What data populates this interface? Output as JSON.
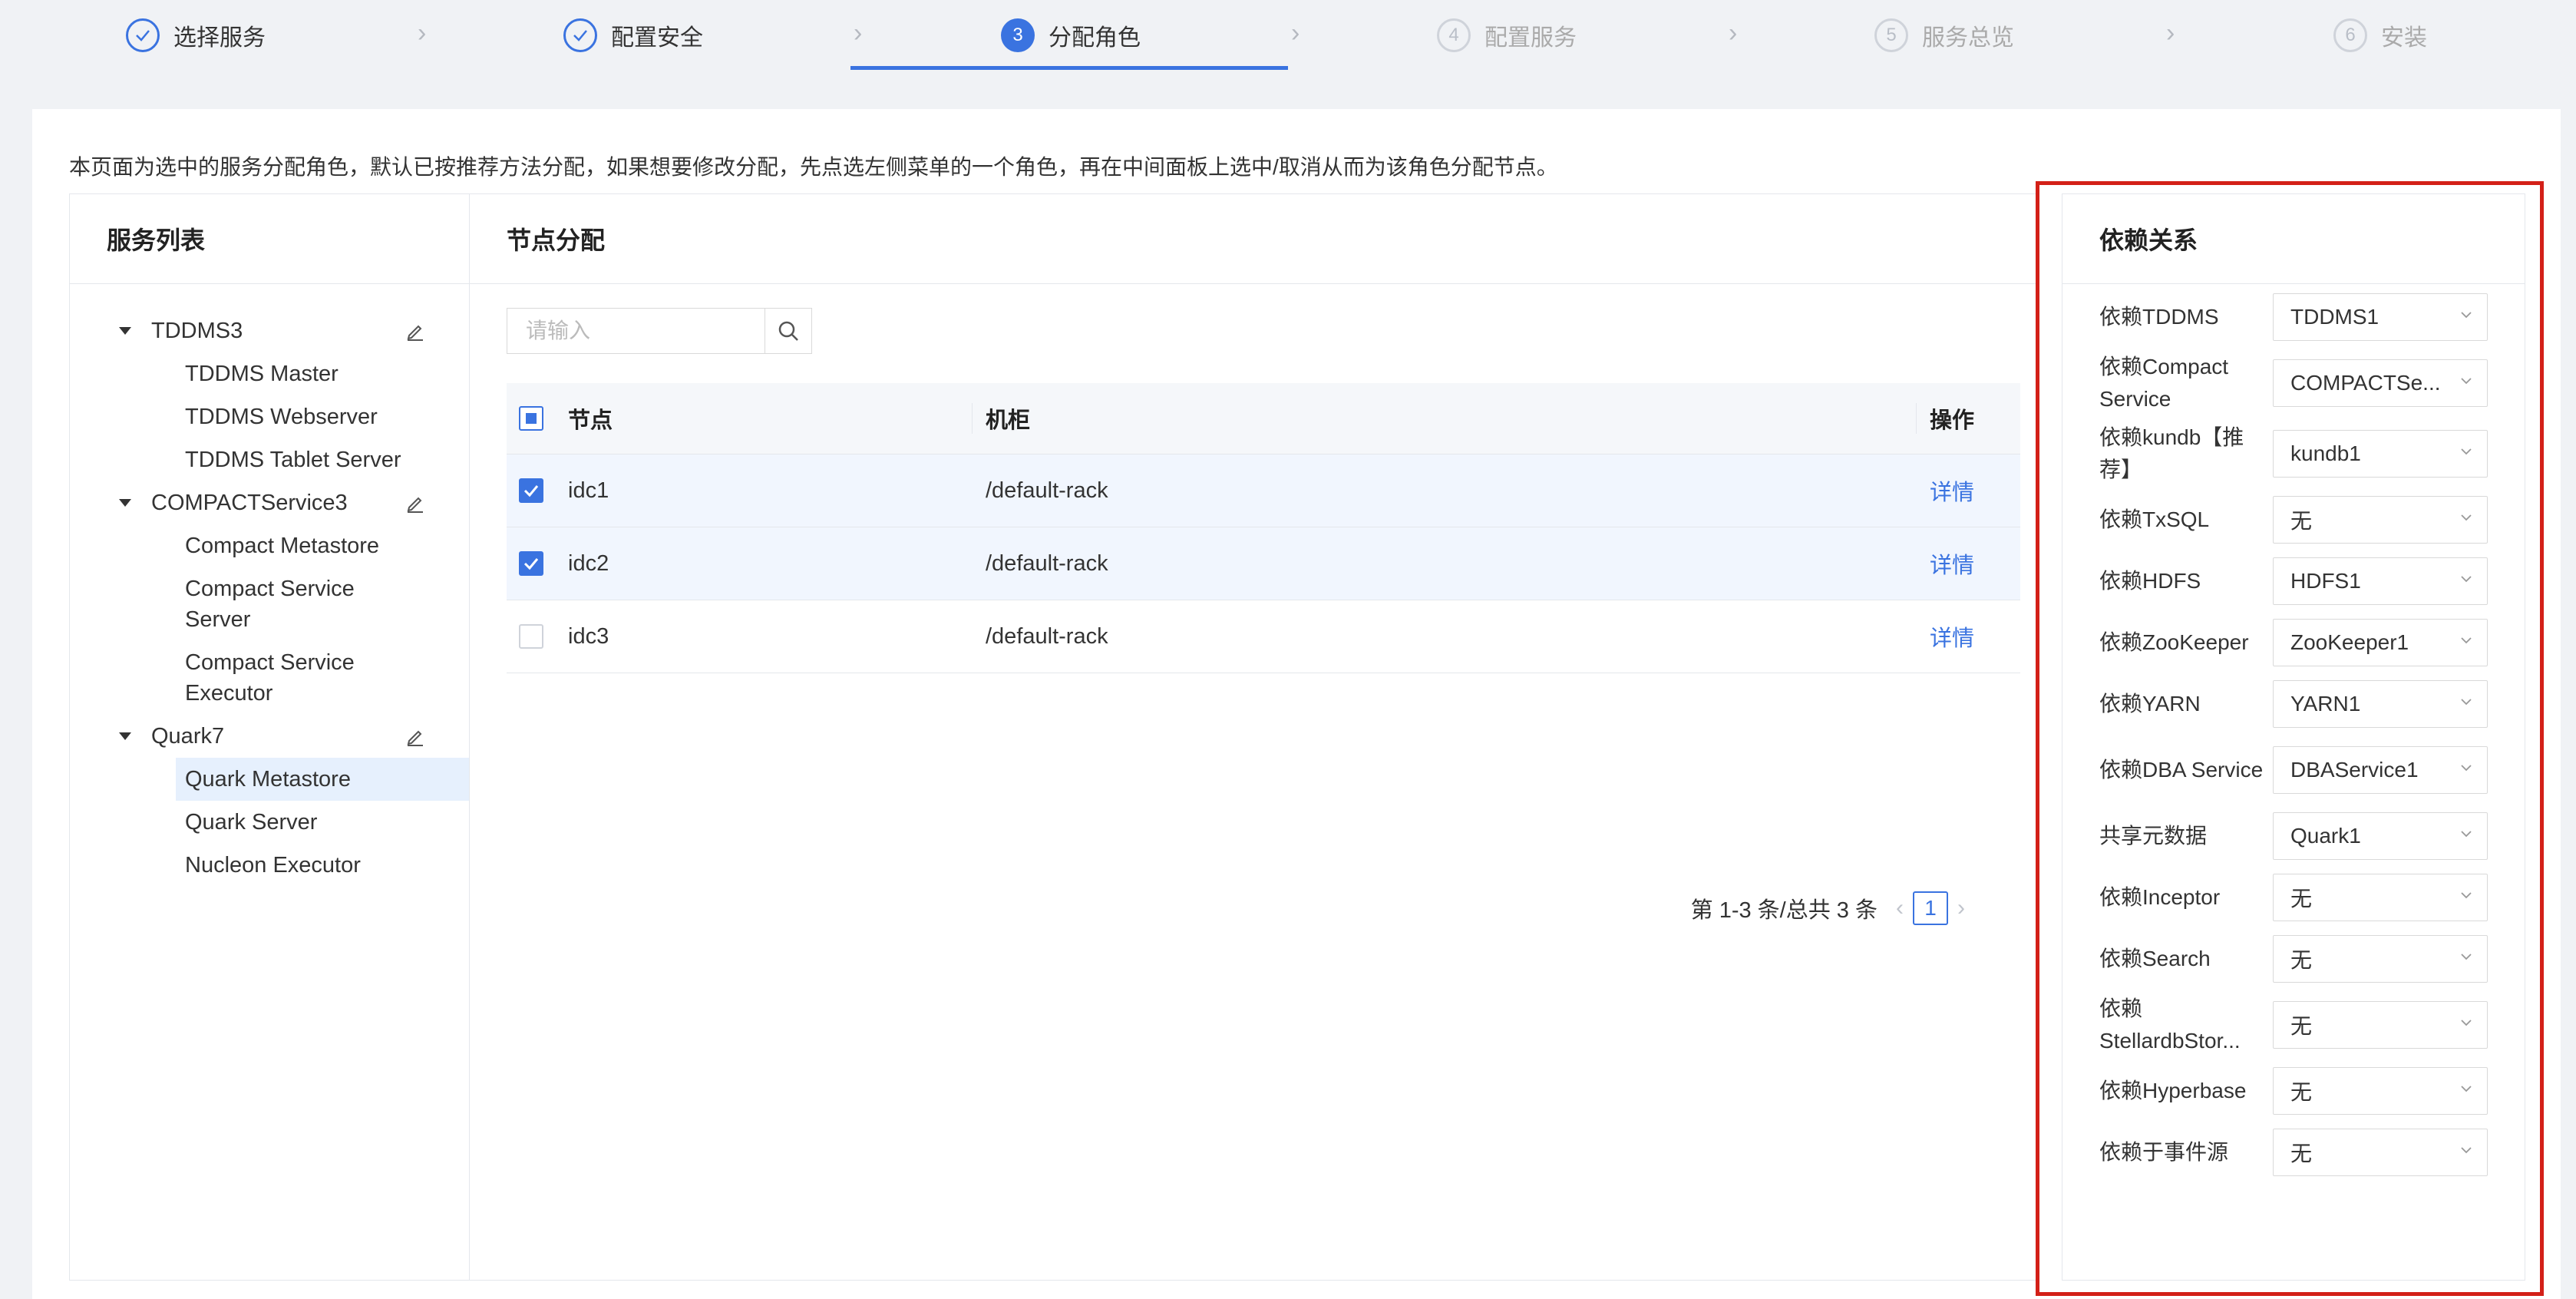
{
  "steps": [
    {
      "label": "选择服务",
      "num": "",
      "state": "done"
    },
    {
      "label": "配置安全",
      "num": "",
      "state": "done"
    },
    {
      "label": "分配角色",
      "num": "3",
      "state": "active"
    },
    {
      "label": "配置服务",
      "num": "4",
      "state": "wait"
    },
    {
      "label": "服务总览",
      "num": "5",
      "state": "wait"
    },
    {
      "label": "安装",
      "num": "6",
      "state": "wait"
    }
  ],
  "description": "本页面为选中的服务分配角色，默认已按推荐方法分配，如果想要修改分配，先点选左侧菜单的一个角色，再在中间面板上选中/取消从而为该角色分配节点。",
  "left_panel": {
    "title": "服务列表",
    "groups": [
      {
        "name": "TDDMS3",
        "items": [
          "TDDMS Master",
          "TDDMS Webserver",
          "TDDMS Tablet Server"
        ]
      },
      {
        "name": "COMPACTService3",
        "items": [
          "Compact Metastore",
          "Compact Service Server",
          "Compact Service Executor"
        ]
      },
      {
        "name": "Quark7",
        "items": [
          "Quark Metastore",
          "Quark Server",
          "Nucleon Executor"
        ]
      }
    ],
    "selected_item": "Quark Metastore"
  },
  "center_panel": {
    "title": "节点分配",
    "search_placeholder": "请输入",
    "columns": {
      "node": "节点",
      "rack": "机柜",
      "op": "操作"
    },
    "rows": [
      {
        "node": "idc1",
        "rack": "/default-rack",
        "op": "详情",
        "checked": true
      },
      {
        "node": "idc2",
        "rack": "/default-rack",
        "op": "详情",
        "checked": true
      },
      {
        "node": "idc3",
        "rack": "/default-rack",
        "op": "详情",
        "checked": false
      }
    ],
    "pagination": {
      "summary": "第 1-3 条/总共 3 条",
      "current_page": "1"
    }
  },
  "right_panel": {
    "title": "依赖关系",
    "deps": [
      {
        "label": "依赖TDDMS",
        "value": "TDDMS1"
      },
      {
        "label": "依赖Compact Service",
        "value": "COMPACTSe..."
      },
      {
        "label": "依赖kundb【推荐】",
        "value": "kundb1"
      },
      {
        "label": "依赖TxSQL",
        "value": "无"
      },
      {
        "label": "依赖HDFS",
        "value": "HDFS1"
      },
      {
        "label": "依赖ZooKeeper",
        "value": "ZooKeeper1"
      },
      {
        "label": "依赖YARN",
        "value": "YARN1"
      },
      {
        "label": "依赖DBA Service",
        "value": "DBAService1"
      },
      {
        "label": "共享元数据",
        "value": "Quark1"
      },
      {
        "label": "依赖Inceptor",
        "value": "无"
      },
      {
        "label": "依赖Search",
        "value": "无"
      },
      {
        "label": "依赖StellardbStor...",
        "value": "无"
      },
      {
        "label": "依赖Hyperbase",
        "value": "无"
      },
      {
        "label": "依赖于事件源",
        "value": "无"
      }
    ]
  },
  "colors": {
    "accent": "#3a73e0",
    "highlight_border": "#d32018",
    "selected_bg": "#e6f0fd"
  }
}
